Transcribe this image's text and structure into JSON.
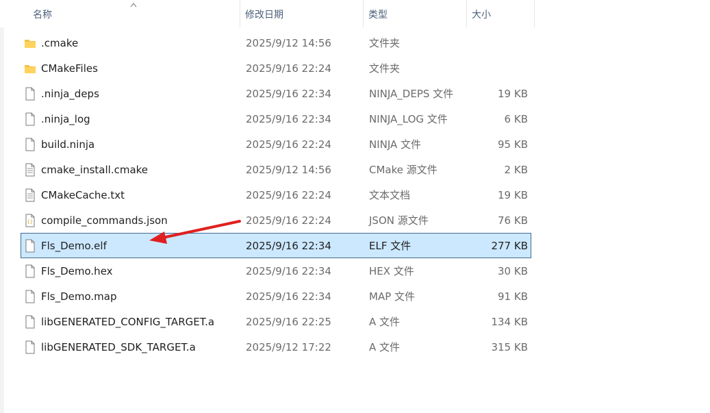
{
  "columns": {
    "name": "名称",
    "date": "修改日期",
    "type": "类型",
    "size": "大小"
  },
  "files": [
    {
      "name": ".cmake",
      "date": "2025/9/12 14:56",
      "type": "文件夹",
      "size": "",
      "icon": "folder-icon"
    },
    {
      "name": "CMakeFiles",
      "date": "2025/9/16 22:24",
      "type": "文件夹",
      "size": "",
      "icon": "folder-icon"
    },
    {
      "name": ".ninja_deps",
      "date": "2025/9/16 22:34",
      "type": "NINJA_DEPS 文件",
      "size": "19 KB",
      "icon": "file-icon"
    },
    {
      "name": ".ninja_log",
      "date": "2025/9/16 22:34",
      "type": "NINJA_LOG 文件",
      "size": "6 KB",
      "icon": "file-icon"
    },
    {
      "name": "build.ninja",
      "date": "2025/9/16 22:24",
      "type": "NINJA 文件",
      "size": "95 KB",
      "icon": "file-icon"
    },
    {
      "name": "cmake_install.cmake",
      "date": "2025/9/12 14:56",
      "type": "CMake 源文件",
      "size": "2 KB",
      "icon": "text-file-icon"
    },
    {
      "name": "CMakeCache.txt",
      "date": "2025/9/16 22:24",
      "type": "文本文档",
      "size": "19 KB",
      "icon": "text-file-icon"
    },
    {
      "name": "compile_commands.json",
      "date": "2025/9/16 22:24",
      "type": "JSON 源文件",
      "size": "76 KB",
      "icon": "json-file-icon"
    },
    {
      "name": "Fls_Demo.elf",
      "date": "2025/9/16 22:34",
      "type": "ELF 文件",
      "size": "277 KB",
      "icon": "file-icon",
      "selected": true
    },
    {
      "name": "Fls_Demo.hex",
      "date": "2025/9/16 22:34",
      "type": "HEX 文件",
      "size": "30 KB",
      "icon": "file-icon"
    },
    {
      "name": "Fls_Demo.map",
      "date": "2025/9/16 22:34",
      "type": "MAP 文件",
      "size": "91 KB",
      "icon": "file-icon"
    },
    {
      "name": "libGENERATED_CONFIG_TARGET.a",
      "date": "2025/9/16 22:25",
      "type": "A 文件",
      "size": "134 KB",
      "icon": "file-icon"
    },
    {
      "name": "libGENERATED_SDK_TARGET.a",
      "date": "2025/9/12 17:22",
      "type": "A 文件",
      "size": "315 KB",
      "icon": "file-icon"
    }
  ],
  "colors": {
    "selection_bg": "#cce8ff",
    "selection_border": "#3f6a93",
    "folder": "#f5c04a",
    "annotation_arrow": "#e02020"
  }
}
